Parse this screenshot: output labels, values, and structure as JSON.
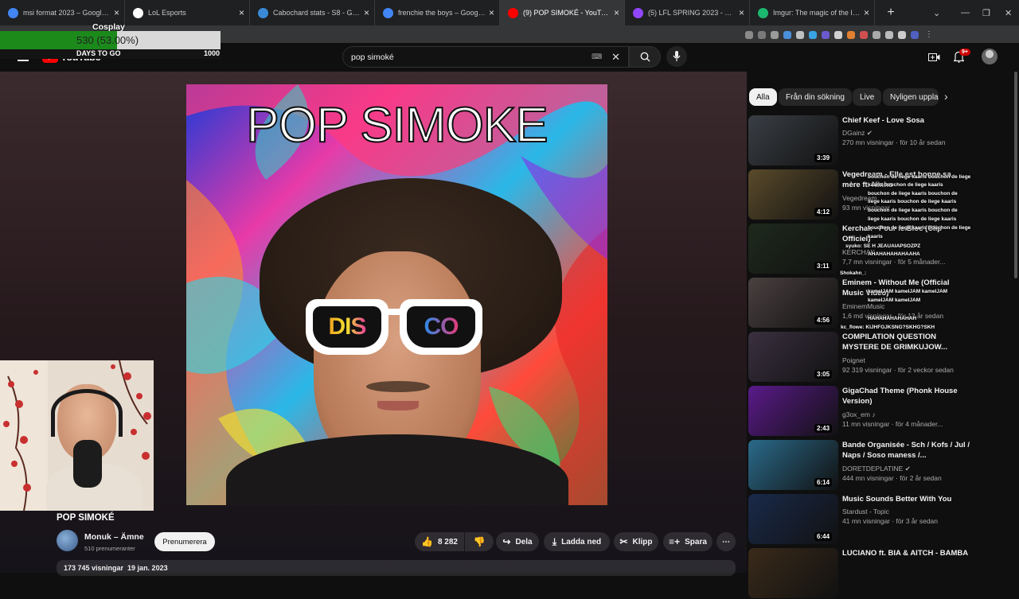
{
  "tabs": [
    {
      "label": "msi format 2023 – Google Sök",
      "color": "#4285f4",
      "active": false
    },
    {
      "label": "LoL Esports",
      "color": "#ffffff",
      "active": false
    },
    {
      "label": "Cabochard stats - S8 - Games o",
      "color": "#3a8ad8",
      "active": false
    },
    {
      "label": "frenchie the boys – Google Sök",
      "color": "#4285f4",
      "active": false
    },
    {
      "label": "(9) POP SIMOKÉ - YouTube",
      "color": "#ff0000",
      "active": true
    },
    {
      "label": "(5) LFL SPRING 2023 - W7D1 - T",
      "color": "#9146ff",
      "active": false
    },
    {
      "label": "Imgur: The magic of the Interne",
      "color": "#1bb76e",
      "active": false
    }
  ],
  "overlay": {
    "title": "Cosplay",
    "progress_text": "530 (53.00%)",
    "progress": 0.53,
    "days_label": "DAYS TO GO",
    "goal": "1000"
  },
  "youtube": {
    "logo": "YouTube",
    "notif_badge": "9+"
  },
  "search": {
    "value": "pop simoké"
  },
  "video": {
    "thumb_title": "POP SIMOKE",
    "glasses_left": "DIS",
    "glasses_right": "CO",
    "title": "POP SIMOKÉ",
    "channel": "Monuk – Ämne",
    "subscribers": "510 prenumeranter",
    "subscribe": "Prenumerera",
    "likes": "8 282",
    "share": "Dela",
    "download": "Ladda ned",
    "clip": "Klipp",
    "save": "Spara",
    "desc_meta": "173 745 visningar  19 jan. 2023"
  },
  "chips": [
    "Alla",
    "Från din sökning",
    "Live",
    "Nyligen uppla"
  ],
  "recs": [
    {
      "title": "Chief Keef - Love Sosa",
      "channel": "DGainz ✔",
      "meta": "270 mn visningar  · för 10 år sedan",
      "duration": "3:39",
      "color": "#3a3f45"
    },
    {
      "title": "Vegedream - Elle est bonne sa mère ft. Ninho",
      "channel": "Vegedream",
      "meta": "93 mn visningar",
      "duration": "4:12",
      "color": "#5a4a2a"
    },
    {
      "title": "Kerchak - Pour le Bloc (Clip Officiel)",
      "channel": "KERCHAK",
      "meta": "7,7 mn visningar  · för 5 månader...",
      "duration": "3:11",
      "color": "#1e2a1c"
    },
    {
      "title": "Eminem - Without Me (Official Music Video)",
      "channel": "EminemMusic",
      "meta": "1,6 md visningar  · för 13 år sedan",
      "duration": "4:56",
      "color": "#4a4040"
    },
    {
      "title": "COMPILATION QUESTION MYSTERE DE GRIMKUJOW...",
      "channel": "Poignet",
      "meta": "92 319 visningar  · för 2 veckor sedan",
      "duration": "3:05",
      "color": "#3a3040"
    },
    {
      "title": "GigaChad Theme (Phonk House Version)",
      "channel": "g3ox_em ♪",
      "meta": "11 mn visningar  · för 4 månader...",
      "duration": "2:43",
      "color": "#5a1a8a"
    },
    {
      "title": "Bande Organisée - Sch / Kofs / Jul / Naps / Soso maness /...",
      "channel": "DORETDEPLATINE ✔",
      "meta": "444 mn visningar  · för 2 år sedan",
      "duration": "6:14",
      "color": "#2a6a8a"
    },
    {
      "title": "Music Sounds Better With You",
      "channel": "Stardust - Topic",
      "meta": "41 mn visningar  · för 3 år sedan",
      "duration": "6:44",
      "color": "#1a2a4a"
    },
    {
      "title": "LUCIANO ft. BIA & AITCH - BAMBA",
      "channel": "",
      "meta": "",
      "duration": "",
      "color": "#3a2a1a"
    }
  ],
  "chat": [
    "bouchon de liege kaaris bouchon de liege",
    "kaaris bouchon de liege kaaris",
    "bouchon de liege kaaris bouchon de",
    "liege kaaris bouchon de liege kaaris",
    "bouchon de liege kaaris bouchon de",
    "liege kaaris bouchon de liege kaaris",
    "bouchon de liege kaaris bouchon de liege",
    "kaaris",
    "syuko: SE H JEAUAIAPSOZPZ",
    "AHAHAHAHAHAAHA",
    "Shokahn_:",
    "kameIJAM kameIJAM kameIJAM",
    "kameIJAM kameIJAM",
    "HAHAHAHAHAHAH",
    "kc_flowe: KIJHFGJKSNG?SKHG?SKH"
  ]
}
